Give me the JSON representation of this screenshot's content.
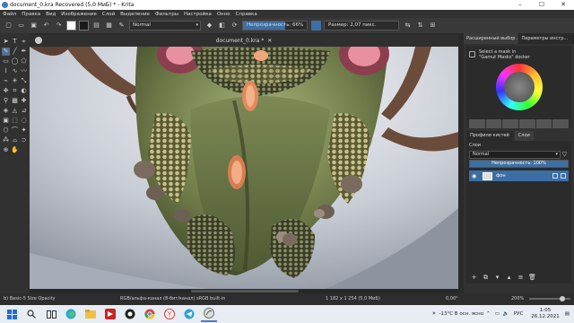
{
  "window": {
    "title": "document_0.kra Recovered  (5,0 МиБ) * - Krita",
    "minimize": "–",
    "maximize": "☐",
    "close": "✕"
  },
  "menu": [
    "Файл",
    "Правка",
    "Вид",
    "Изображение",
    "Слой",
    "Выделение",
    "Фильтры",
    "Настройка",
    "Окно",
    "Справка"
  ],
  "toolbar": {
    "blend_mode": "Normal",
    "opacity_label": "Непрозрачность: 66%",
    "opacity_value": 66,
    "size_label": "Размер: 2,07 пикс.",
    "fg_color": "#ffffff",
    "bg_color": "#1a1a1a"
  },
  "document_tab": {
    "title": "document_0.kra *",
    "close": "✕"
  },
  "docker": {
    "tabs": [
      "Расширенный выбор ...",
      "Параметры инстр..."
    ],
    "selector_hint_line1": "Select a mask in",
    "selector_hint_line2": "\"Gamut Masks\" docker",
    "panel_tabs": [
      "Профили кистей",
      "Слои"
    ],
    "layers_title": "Слои",
    "layer_blend": "Normal",
    "layer_opacity_label": "Непрозрачность: 100%",
    "layer_opacity_value": 100,
    "layers": [
      {
        "name": "фон"
      }
    ]
  },
  "status": {
    "brush": "b) Basic-5 Size Opacity",
    "color_profile": "RGB/альфа-канал (8-бит/канал)  sRGB built-in",
    "dimensions": "1 182 x 1 254 (5,0 МиБ)",
    "angle": "0,00°",
    "zoom": "200%"
  },
  "taskbar": {
    "weather": "-13°C  В осн. ясно",
    "lang": "РУС",
    "time": "1:05",
    "date": "26.12.2021"
  },
  "colors": {
    "accent": "#3e6fa3",
    "selected_layer": "#3c6ea3"
  }
}
